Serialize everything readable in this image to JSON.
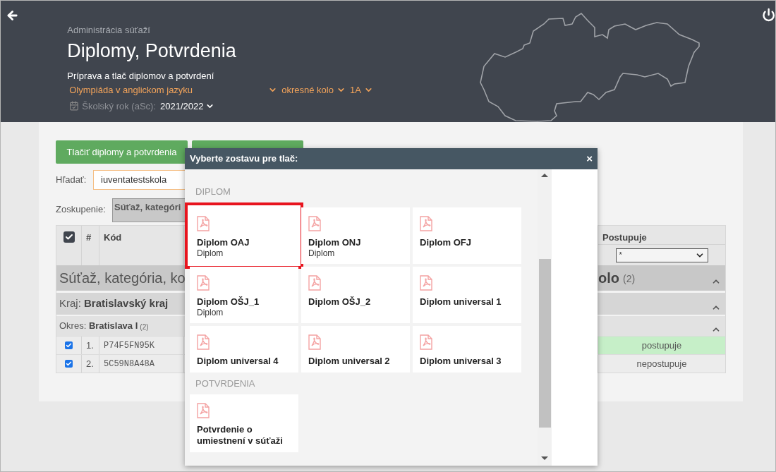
{
  "header": {
    "breadcrumb": "Administrácia súťaží",
    "title": "Diplomy, Potvrdenia",
    "subtitle": "Príprava a tlač diplomov a potvrdení",
    "filters": [
      {
        "label": "Olympiáda v anglickom jazyku"
      },
      {
        "label": "okresné kolo"
      },
      {
        "label": "1A"
      }
    ],
    "school_year": {
      "label": "Školský rok (aSc):",
      "value": "2021/2022"
    }
  },
  "toolbar": {
    "print_button": "Tlačiť diplomy a potvrdenia",
    "search": {
      "label": "Hľadať:",
      "value": "iuventatestskola"
    },
    "grouping": {
      "label": "Zoskupenie:",
      "value": "Súťaž, kategóri"
    }
  },
  "table": {
    "columns": [
      "#",
      "Kód",
      "Postupuje"
    ],
    "all_checked": true,
    "status_filter": "*",
    "groups": [
      {
        "kind": "competition",
        "text_left": "Súťaž, kategória, ko",
        "text_right": "olo",
        "count": "(2)",
        "expanded": true
      },
      {
        "kind": "region",
        "label": "Kraj:",
        "value": "Bratislavský kraj",
        "expanded": true
      },
      {
        "kind": "district",
        "label": "Okres:",
        "value": "Bratislava I",
        "count": "(2)",
        "expanded": true
      }
    ],
    "rows": [
      {
        "checked": true,
        "number": "1.",
        "code": "P74F5FN95K",
        "status": "postupuje",
        "advancing": true
      },
      {
        "checked": true,
        "number": "2.",
        "code": "5C59N8A48A",
        "status": "nepostupuje",
        "advancing": false
      }
    ]
  },
  "modal": {
    "title": "Vyberte zostavu pre tlač:",
    "close": "×",
    "sections": [
      {
        "heading": "DIPLOM",
        "items": [
          {
            "name": "Diplom OAJ",
            "type": "Diplom",
            "selected": true
          },
          {
            "name": "Diplom ONJ",
            "type": "Diplom",
            "selected": false
          },
          {
            "name": "Diplom OFJ",
            "selected": false
          },
          {
            "name": "Diplom OŠJ_1",
            "type": "Diplom",
            "selected": false
          },
          {
            "name": "Diplom OŠJ_2",
            "selected": false
          },
          {
            "name": "Diplom universal 1",
            "selected": false
          },
          {
            "name": "Diplom universal 4",
            "selected": false
          },
          {
            "name": "Diplom universal 2",
            "selected": false
          },
          {
            "name": "Diplom universal 3",
            "selected": false
          }
        ]
      },
      {
        "heading": "POTVRDENIA",
        "items": [
          {
            "name": "Potvrdenie o umiestnení v súťaži",
            "selected": false
          }
        ]
      }
    ]
  }
}
